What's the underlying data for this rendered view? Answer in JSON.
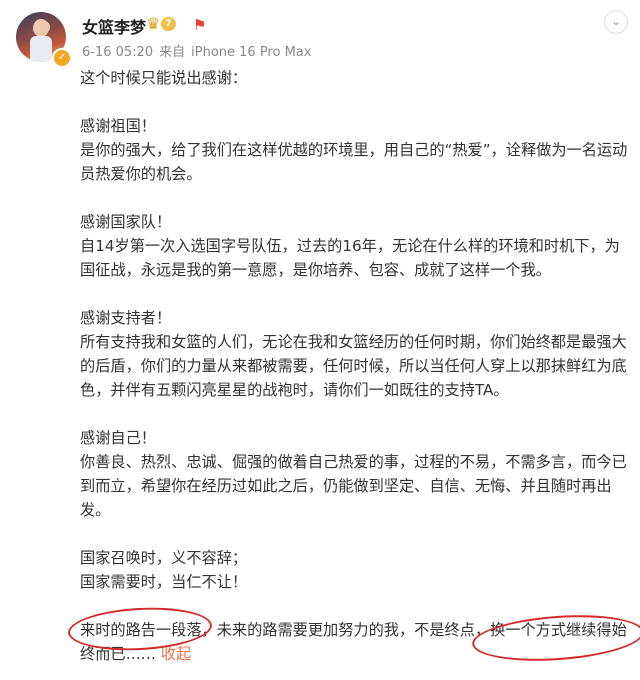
{
  "header": {
    "username": "女篮李梦",
    "vip_level": "7",
    "date": "6-16 05:20",
    "source_prefix": "来自",
    "device": "iPhone 16 Pro Max",
    "avatar_icon": "user-avatar-photo",
    "verified_icon": "verified-badge-icon",
    "flag_icon": "red-flag-icon",
    "more_icon": "chevron-down-icon"
  },
  "post": {
    "intro": "这个时候只能说出感谢：",
    "s1_title": "感谢祖国！",
    "s1_line1": "是你的强大，给了我们在这样优越的环境里，用自己的“热爱”，诠释做为一名运动",
    "s1_line2": "员热爱你的机会。",
    "s2_title": "感谢国家队！",
    "s2_line1": "自14岁第一次入选国字号队伍，过去的16年，无论在什么样的环境和时机下，为",
    "s2_line2": "国征战，永远是我的第一意愿，是你培养、包容、成就了这样一个我。",
    "s3_title": "感谢支持者！",
    "s3_line1": "所有支持我和女篮的人们，无论在我和女篮经历的任何时期，你们始终都是最强大",
    "s3_line2": "的后盾，你们的力量从来都被需要，任何时候，所以当任何人穿上以那抹鲜红为底",
    "s3_line3": "色，并伴有五颗闪亮星星的战袍时，请你们一如既往的支持TA。",
    "s4_title": "感谢自己！",
    "s4_line1": "你善良、热烈、忠诚、倔强的做着自己热爱的事，过程的不易，不需多言，而今已",
    "s4_line2": "到而立，希望你在经历过如此之后，仍能做到坚定、自信、无悔、并且随时再出",
    "s4_line3": "发。",
    "s5_line1": "国家召唤时，义不容辞；",
    "s5_line2": "国家需要时，当仁不让！",
    "s6_line1": "来时的路告一段落，未来的路需要更加努力的我，不是终点，换一个方式继续得始",
    "s6_line2": "终而已……",
    "collapse_label": "收起"
  },
  "colors": {
    "link": "#eb7350",
    "annotation_circle": "#d52a2a",
    "meta_text": "#888888"
  }
}
